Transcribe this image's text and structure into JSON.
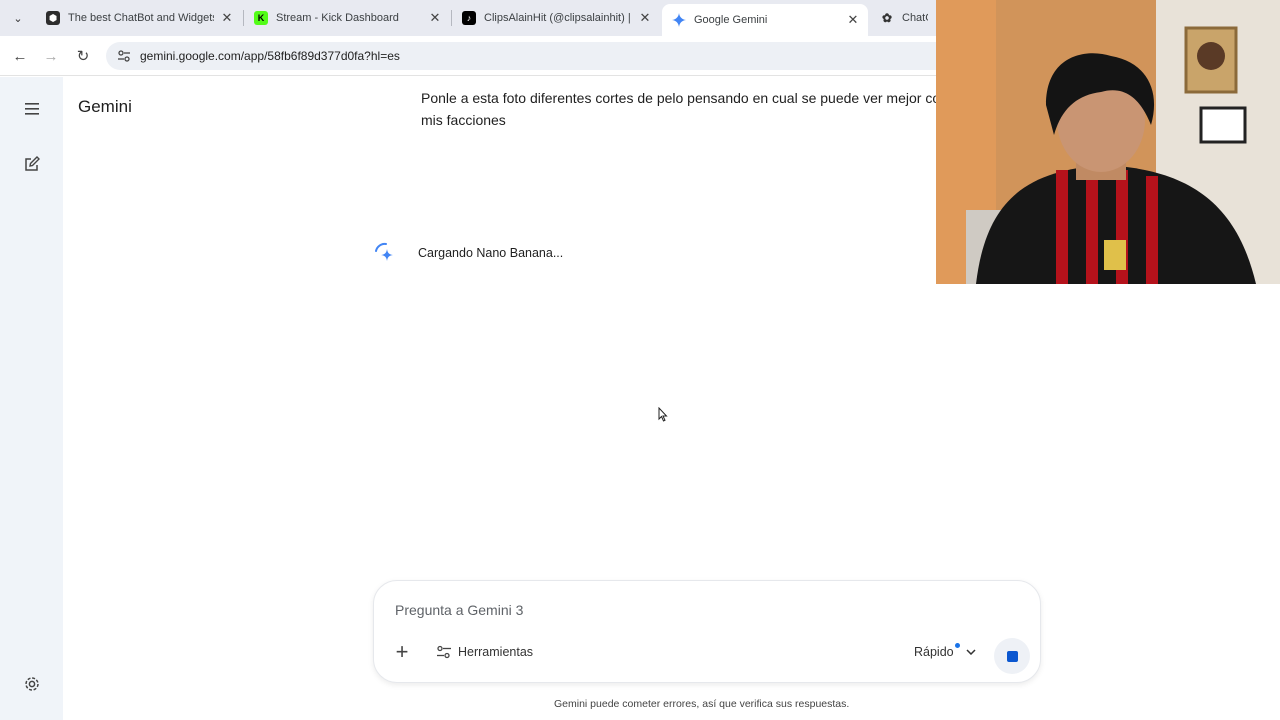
{
  "browser": {
    "tabs": [
      {
        "title": "The best ChatBot and Widgets",
        "icon": "hexagon-icon",
        "active": false
      },
      {
        "title": "Stream - Kick Dashboard",
        "icon": "kick-icon",
        "active": false
      },
      {
        "title": "ClipsAlainHit (@clipsalainhit) | T",
        "icon": "tiktok-icon",
        "active": false
      },
      {
        "title": "Google Gemini",
        "icon": "gemini-icon",
        "active": true
      },
      {
        "title": "ChatGP",
        "icon": "chatgpt-icon",
        "active": false
      }
    ],
    "close_glyph": "✕",
    "url": "gemini.google.com/app/58fb6f89d377d0fa?hl=es"
  },
  "app": {
    "name": "Gemini"
  },
  "chat": {
    "user_prompt": "Ponle a esta foto diferentes cortes de pelo pensando en cual se puede ver mejor considerando mis facciones",
    "loading_text": "Cargando Nano Banana..."
  },
  "composer": {
    "placeholder": "Pregunta a Gemini 3",
    "tools_label": "Herramientas",
    "mode_label": "Rápido",
    "add_glyph": "+"
  },
  "footer": {
    "disclaimer": "Gemini puede cometer errores, así que verifica sus respuestas."
  },
  "colors": {
    "accent": "#0b57d0",
    "sidebar_bg": "#f0f4f9",
    "tabstrip_bg": "#e8eaf1"
  }
}
